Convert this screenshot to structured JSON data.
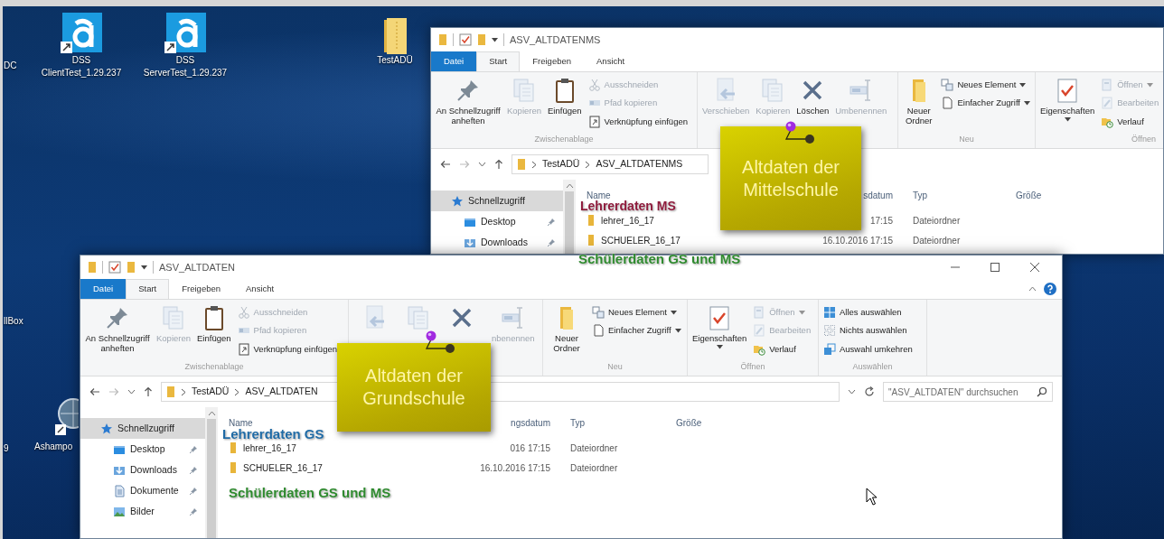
{
  "desktop_icons": [
    {
      "kind": "label",
      "lines": [
        "DC"
      ]
    },
    {
      "kind": "app",
      "lines": [
        "DSS",
        "ClientTest_1.29.237"
      ]
    },
    {
      "kind": "app",
      "lines": [
        "DSS",
        "ServerTest_1.29.237"
      ]
    },
    {
      "kind": "folder",
      "lines": [
        "TestADÜ"
      ]
    },
    {
      "kind": "label",
      "lines": [
        "llBox"
      ]
    },
    {
      "kind": "label",
      "lines": [
        "9"
      ]
    },
    {
      "kind": "globe",
      "lines": [
        "Ashampo"
      ]
    }
  ],
  "windows": [
    {
      "title": "ASV_ALTDATENMS",
      "controls": false,
      "tabs": [
        {
          "kind": "file",
          "label": "Datei",
          "selected": false
        },
        {
          "kind": "tab",
          "label": "Start",
          "selected": true
        },
        {
          "kind": "tab",
          "label": "Freigeben",
          "selected": false
        },
        {
          "kind": "tab",
          "label": "Ansicht",
          "selected": false
        }
      ],
      "ribbon": [
        {
          "label": "Zwischenablage",
          "items": [
            {
              "kind": "pin",
              "label": "An Schnellzugriff anheften",
              "disabled": false
            },
            {
              "kind": "copy",
              "label": "Kopieren",
              "disabled": true
            },
            {
              "kind": "paste",
              "label": "Einfügen",
              "disabled": false
            },
            {
              "kind": "stack",
              "items": [
                {
                  "kind": "cut",
                  "label": "Ausschneiden",
                  "disabled": true
                },
                {
                  "kind": "path",
                  "label": "Pfad kopieren",
                  "disabled": true
                },
                {
                  "kind": "shortcut",
                  "label": "Verknüpfung einfügen",
                  "disabled": false
                }
              ]
            }
          ]
        },
        {
          "items": [
            {
              "kind": "move",
              "label": "Verschieben",
              "disabled": true
            },
            {
              "kind": "copyto",
              "label": "Kopieren",
              "disabled": true
            },
            {
              "kind": "delete",
              "label": "Löschen",
              "disabled": false
            },
            {
              "kind": "rename",
              "label": "Umbenennen",
              "disabled": true
            }
          ]
        },
        {
          "label": "Neu",
          "items": [
            {
              "kind": "newfolder",
              "label": "Neuer Ordner",
              "disabled": false
            },
            {
              "kind": "stack",
              "items": [
                {
                  "kind": "newitem",
                  "label": "Neues Element",
                  "disabled": false,
                  "dropdown": true
                },
                {
                  "kind": "easy",
                  "label": "Einfacher Zugriff",
                  "disabled": false,
                  "dropdown": true
                }
              ]
            }
          ]
        },
        {
          "label": "Öffnen",
          "items": [
            {
              "kind": "props",
              "label": "Eigenschaften",
              "disabled": false,
              "dropdown": true
            },
            {
              "kind": "stack",
              "items": [
                {
                  "kind": "open",
                  "label": "Öffnen",
                  "disabled": true,
                  "dropdown": true
                },
                {
                  "kind": "edit",
                  "label": "Bearbeiten",
                  "disabled": true
                },
                {
                  "kind": "history",
                  "label": "Verlauf",
                  "disabled": false
                }
              ]
            }
          ]
        }
      ],
      "address": {
        "crumbs": [
          "TestADÜ",
          "ASV_ALTDATENMS"
        ]
      },
      "nav": [
        {
          "kind": "star",
          "label": "Schnellzugriff",
          "selected": true,
          "pinned": false,
          "children": [
            {
              "kind": "desktop",
              "label": "Desktop",
              "selected": false,
              "pinned": true
            },
            {
              "kind": "downloads",
              "label": "Downloads",
              "selected": false,
              "pinned": true
            }
          ]
        }
      ],
      "columns": [
        "Name",
        "sdatum",
        "Typ",
        "Größe"
      ],
      "rows": [
        {
          "name": "lehrer_16_17",
          "date": "17:15",
          "type": "Dateiordner"
        },
        {
          "name": "SCHUELER_16_17",
          "date": "16.10.2016 17:15",
          "type": "Dateiordner"
        }
      ]
    },
    {
      "title": "ASV_ALTDATEN",
      "controls": true,
      "tabs": [
        {
          "kind": "file",
          "label": "Datei",
          "selected": false
        },
        {
          "kind": "tab",
          "label": "Start",
          "selected": true
        },
        {
          "kind": "tab",
          "label": "Freigeben",
          "selected": false
        },
        {
          "kind": "tab",
          "label": "Ansicht",
          "selected": false
        }
      ],
      "ribbon": [
        {
          "label": "Zwischenablage",
          "items": [
            {
              "kind": "pin",
              "label": "An Schnellzugriff anheften",
              "disabled": false
            },
            {
              "kind": "copy",
              "label": "Kopieren",
              "disabled": true
            },
            {
              "kind": "paste",
              "label": "Einfügen",
              "disabled": false
            },
            {
              "kind": "stack",
              "items": [
                {
                  "kind": "cut",
                  "label": "Ausschneiden",
                  "disabled": true
                },
                {
                  "kind": "path",
                  "label": "Pfad kopieren",
                  "disabled": true
                },
                {
                  "kind": "shortcut",
                  "label": "Verknüpfung einfügen",
                  "disabled": false
                }
              ]
            }
          ]
        },
        {
          "items": [
            {
              "kind": "move",
              "disabled": true
            },
            {
              "kind": "copyto",
              "disabled": true
            },
            {
              "kind": "delete",
              "disabled": false
            },
            {
              "kind": "rename",
              "label": "nbenennen",
              "disabled": true
            }
          ]
        },
        {
          "label": "Neu",
          "items": [
            {
              "kind": "newfolder",
              "label": "Neuer Ordner",
              "disabled": false
            },
            {
              "kind": "stack",
              "items": [
                {
                  "kind": "newitem",
                  "label": "Neues Element",
                  "disabled": false,
                  "dropdown": true
                },
                {
                  "kind": "easy",
                  "label": "Einfacher Zugriff",
                  "disabled": false,
                  "dropdown": true
                }
              ]
            }
          ]
        },
        {
          "label": "Öffnen",
          "items": [
            {
              "kind": "props",
              "label": "Eigenschaften",
              "disabled": false,
              "dropdown": true
            },
            {
              "kind": "stack",
              "items": [
                {
                  "kind": "open",
                  "label": "Öffnen",
                  "disabled": true,
                  "dropdown": true
                },
                {
                  "kind": "edit",
                  "label": "Bearbeiten",
                  "disabled": true
                },
                {
                  "kind": "history",
                  "label": "Verlauf",
                  "disabled": false
                }
              ]
            }
          ]
        },
        {
          "label": "Auswählen",
          "items": [
            {
              "kind": "stack",
              "items": [
                {
                  "kind": "selall",
                  "label": "Alles auswählen",
                  "disabled": false
                },
                {
                  "kind": "selnone",
                  "label": "Nichts auswählen",
                  "disabled": false
                },
                {
                  "kind": "invert",
                  "label": "Auswahl umkehren",
                  "disabled": false
                }
              ]
            }
          ]
        }
      ],
      "address": {
        "crumbs": [
          "TestADÜ",
          "ASV_ALTDATEN"
        ],
        "search_placeholder": "\"ASV_ALTDATEN\" durchsuchen"
      },
      "nav": [
        {
          "kind": "star",
          "label": "Schnellzugriff",
          "selected": true,
          "pinned": false,
          "children": [
            {
              "kind": "desktop",
              "label": "Desktop",
              "selected": false,
              "pinned": true
            },
            {
              "kind": "downloads",
              "label": "Downloads",
              "selected": false,
              "pinned": true
            },
            {
              "kind": "documents",
              "label": "Dokumente",
              "selected": false,
              "pinned": true
            },
            {
              "kind": "pictures",
              "label": "Bilder",
              "selected": false,
              "pinned": true
            }
          ]
        }
      ],
      "columns": [
        "Name",
        "ngsdatum",
        "Typ",
        "Größe"
      ],
      "rows": [
        {
          "name": "lehrer_16_17",
          "date": "016 17:15",
          "type": "Dateiordner"
        },
        {
          "name": "SCHUELER_16_17",
          "date": "16.10.2016 17:15",
          "type": "Dateiordner"
        }
      ]
    }
  ],
  "notes": [
    {
      "text": "Altdaten der Mittelschule"
    },
    {
      "text": "Altdaten der Grundschule"
    }
  ],
  "annotations": [
    {
      "text": "Lehrerdaten MS",
      "color": "#8e1b3c"
    },
    {
      "text": "Schülerdaten GS und MS",
      "color": "#2f8a2f"
    },
    {
      "text": "Lehrerdaten GS",
      "color": "#1f6aa5"
    },
    {
      "text": "Schülerdaten GS und MS",
      "color": "#2f8a2f"
    }
  ]
}
